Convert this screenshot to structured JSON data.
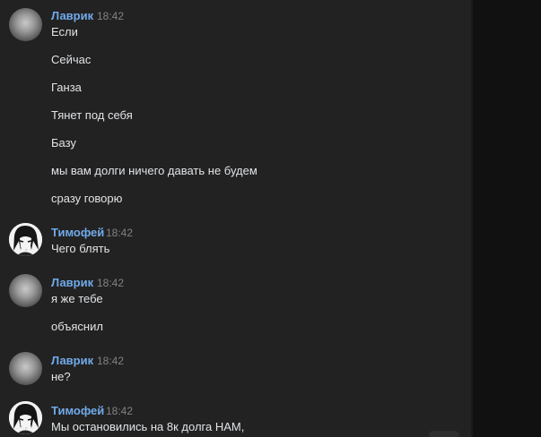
{
  "groups": [
    {
      "author": "Лаврик",
      "time": "18:42",
      "avatar": "lavrik",
      "messages": [
        "Если",
        "Сейчас",
        "Ганза",
        "Тянет под себя",
        "Базу",
        "мы вам долги ничего давать не будем",
        "сразу говорю"
      ]
    },
    {
      "author": "Тимофей",
      "time": "18:42",
      "avatar": "timofei",
      "messages": [
        "Чего блять"
      ]
    },
    {
      "author": "Лаврик",
      "time": "18:42",
      "avatar": "lavrik",
      "messages": [
        "я же тебе",
        "объяснил"
      ]
    },
    {
      "author": "Лаврик",
      "time": "18:42",
      "avatar": "lavrik",
      "messages": [
        "не?"
      ]
    },
    {
      "author": "Тимофей",
      "time": "18:42",
      "avatar": "timofei",
      "messages": [
        "Мы остановились на 8к долга НАМ,"
      ]
    }
  ]
}
